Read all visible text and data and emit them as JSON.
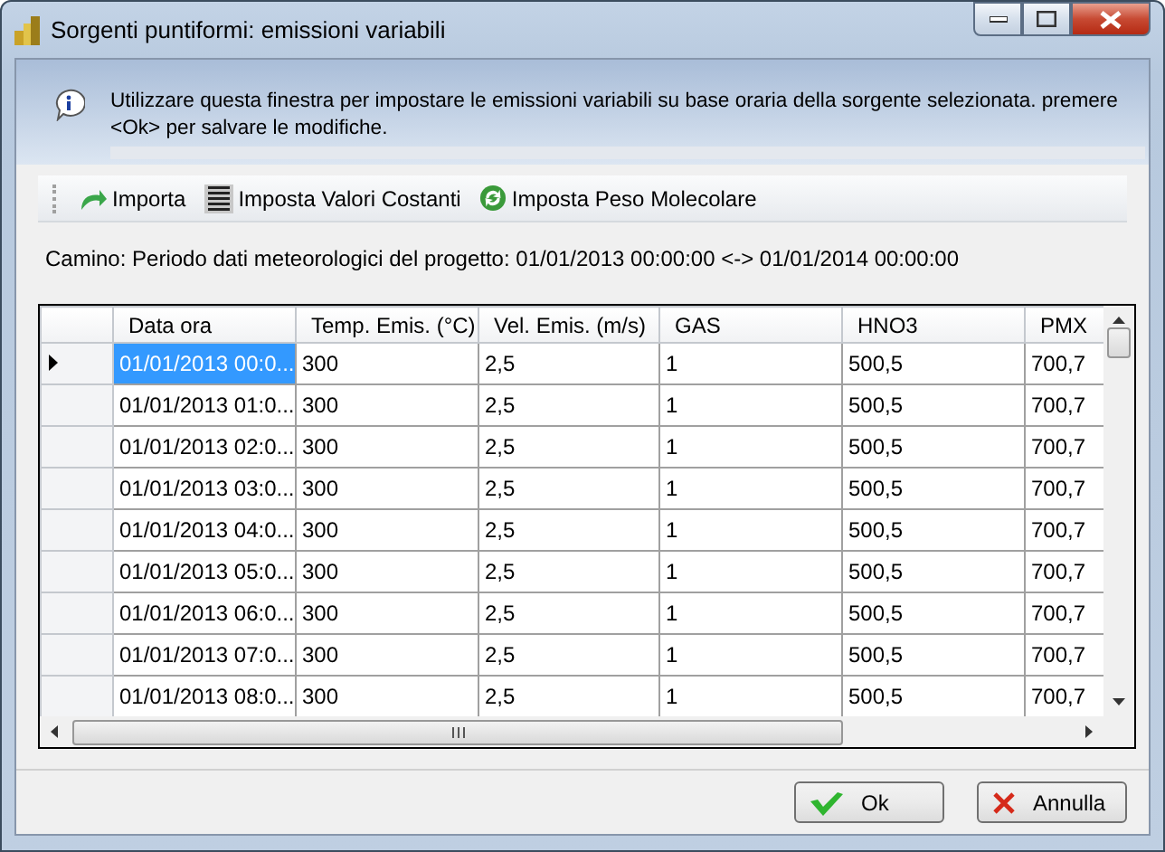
{
  "window": {
    "title": "Sorgenti puntiformi: emissioni variabili"
  },
  "info": {
    "text": "Utilizzare questa finestra per impostare le emissioni variabili su base oraria della sorgente selezionata. premere <Ok> per salvare le modifiche."
  },
  "toolbar": [
    {
      "kind": "import",
      "label": "Importa"
    },
    {
      "kind": "constants",
      "label": "Imposta Valori Costanti"
    },
    {
      "kind": "molecular",
      "label": "Imposta Peso Molecolare"
    }
  ],
  "period": {
    "text": "Camino: Periodo dati meteorologici del progetto:  01/01/2013 00:00:00 <-> 01/01/2014 00:00:00"
  },
  "table": {
    "columns": [
      "Data ora",
      "Temp. Emis. (°C)",
      "Vel. Emis. (m/s)",
      "GAS",
      "HNO3",
      "PMX"
    ],
    "rows": [
      {
        "current": true,
        "selected": true,
        "cells": [
          "01/01/2013 00:0...",
          "300",
          "2,5",
          "1",
          "500,5",
          "700,7"
        ]
      },
      {
        "current": false,
        "selected": false,
        "cells": [
          "01/01/2013 01:0...",
          "300",
          "2,5",
          "1",
          "500,5",
          "700,7"
        ]
      },
      {
        "current": false,
        "selected": false,
        "cells": [
          "01/01/2013 02:0...",
          "300",
          "2,5",
          "1",
          "500,5",
          "700,7"
        ]
      },
      {
        "current": false,
        "selected": false,
        "cells": [
          "01/01/2013 03:0...",
          "300",
          "2,5",
          "1",
          "500,5",
          "700,7"
        ]
      },
      {
        "current": false,
        "selected": false,
        "cells": [
          "01/01/2013 04:0...",
          "300",
          "2,5",
          "1",
          "500,5",
          "700,7"
        ]
      },
      {
        "current": false,
        "selected": false,
        "cells": [
          "01/01/2013 05:0...",
          "300",
          "2,5",
          "1",
          "500,5",
          "700,7"
        ]
      },
      {
        "current": false,
        "selected": false,
        "cells": [
          "01/01/2013 06:0...",
          "300",
          "2,5",
          "1",
          "500,5",
          "700,7"
        ]
      },
      {
        "current": false,
        "selected": false,
        "cells": [
          "01/01/2013 07:0...",
          "300",
          "2,5",
          "1",
          "500,5",
          "700,7"
        ]
      },
      {
        "current": false,
        "selected": false,
        "cells": [
          "01/01/2013 08:0...",
          "300",
          "2,5",
          "1",
          "500,5",
          "700,7"
        ]
      }
    ]
  },
  "buttons": [
    {
      "kind": "ok",
      "label": "Ok"
    },
    {
      "kind": "cancel",
      "label": "Annulla"
    }
  ]
}
